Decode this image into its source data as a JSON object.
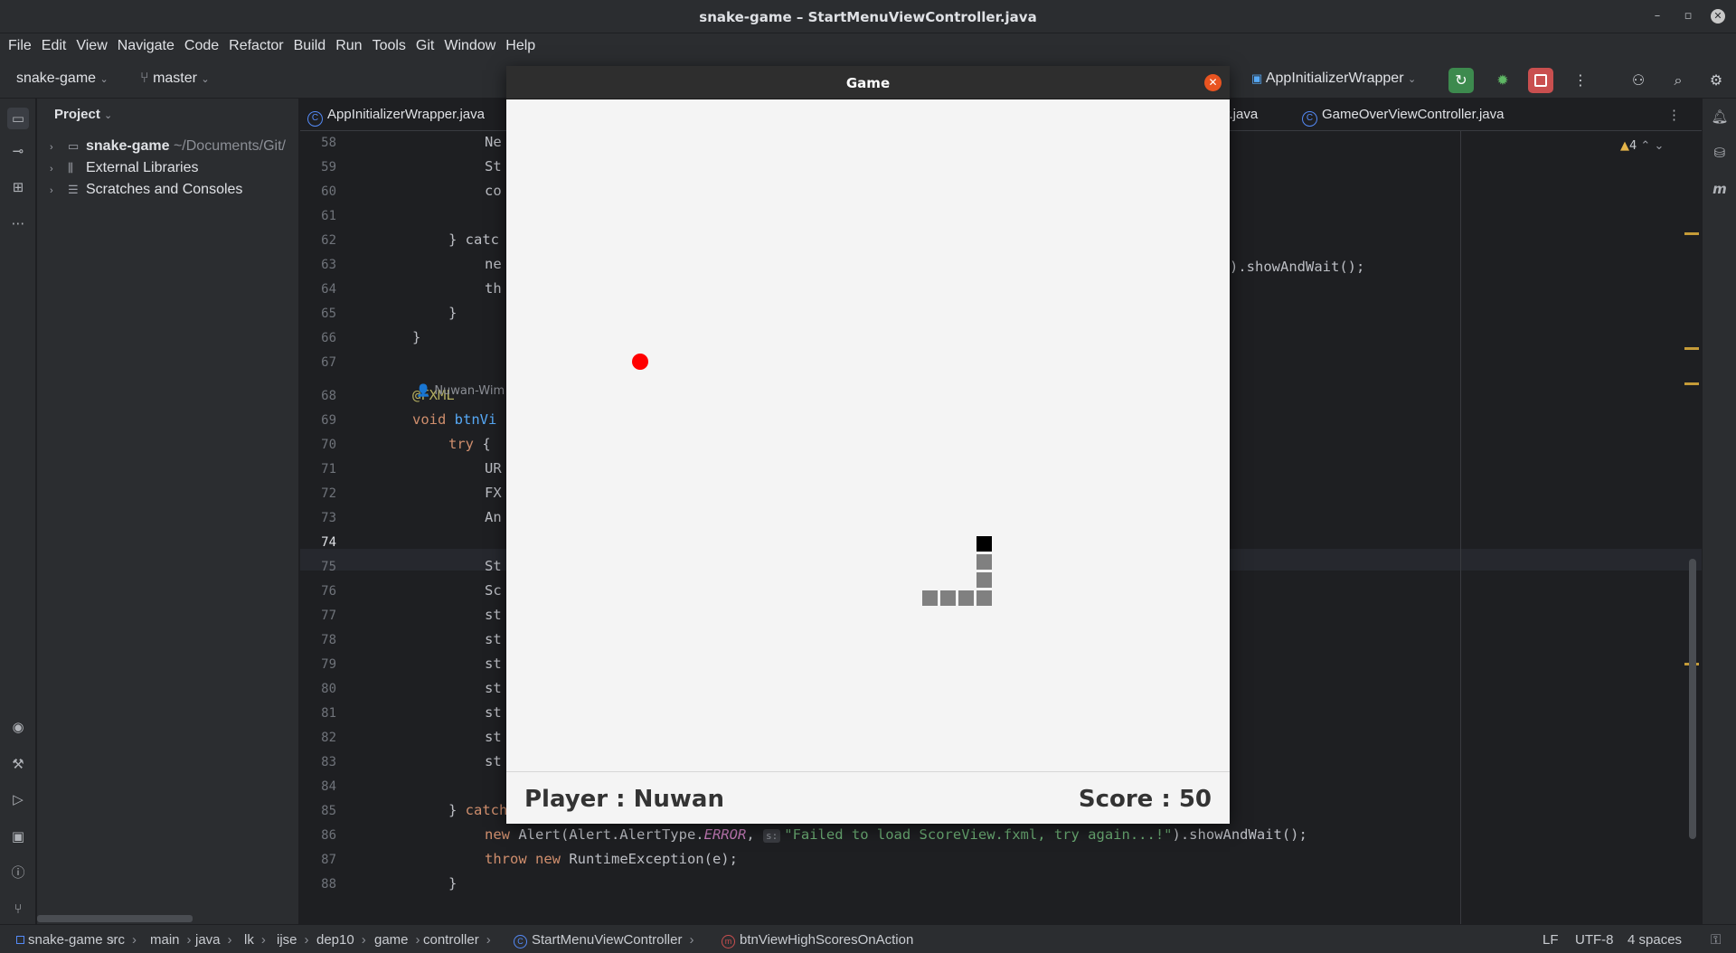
{
  "window": {
    "title": "snake-game – StartMenuViewController.java"
  },
  "menu": [
    "File",
    "Edit",
    "View",
    "Navigate",
    "Code",
    "Refactor",
    "Build",
    "Run",
    "Tools",
    "Git",
    "Window",
    "Help"
  ],
  "toolbar": {
    "project": "snake-game",
    "branch": "master",
    "run_config": "AppInitializerWrapper"
  },
  "project_panel": {
    "header": "Project",
    "items": [
      {
        "label": "snake-game",
        "path": "~/Documents/Git/"
      },
      {
        "label": "External Libraries"
      },
      {
        "label": "Scratches and Consoles"
      }
    ]
  },
  "tabs": [
    {
      "label": "AppInitializerWrapper.java"
    },
    {
      "label": "er.java"
    },
    {
      "label": "GameOverViewController.java"
    }
  ],
  "editor": {
    "warnings": "4",
    "author_hint": "Nuwan-Wim",
    "lines": [
      {
        "n": "58",
        "text": "Ne"
      },
      {
        "n": "59",
        "text": "St"
      },
      {
        "n": "60",
        "text": "co"
      },
      {
        "n": "61",
        "text": ""
      },
      {
        "n": "62",
        "text": "} catc"
      },
      {
        "n": "63",
        "text": "ne"
      },
      {
        "n": "64",
        "text": "th"
      },
      {
        "n": "65",
        "text": "}"
      },
      {
        "n": "66",
        "text": "}"
      },
      {
        "n": "67",
        "text": ""
      },
      {
        "n": "68",
        "text": "@FXML"
      },
      {
        "n": "69",
        "text": "void btnVi"
      },
      {
        "n": "70",
        "text": "try {"
      },
      {
        "n": "71",
        "text": "UR"
      },
      {
        "n": "72",
        "text": "FX"
      },
      {
        "n": "73",
        "text": "An"
      },
      {
        "n": "74",
        "text": ""
      },
      {
        "n": "75",
        "text": "St"
      },
      {
        "n": "76",
        "text": "Sc"
      },
      {
        "n": "77",
        "text": "st"
      },
      {
        "n": "78",
        "text": "st"
      },
      {
        "n": "79",
        "text": "st"
      },
      {
        "n": "80",
        "text": "st"
      },
      {
        "n": "81",
        "text": "st"
      },
      {
        "n": "82",
        "text": "st"
      },
      {
        "n": "83",
        "text": "st"
      },
      {
        "n": "84",
        "text": ""
      },
      {
        "n": "85",
        "text": "} catch (IOException e) {"
      },
      {
        "n": "86",
        "text": "new Alert(Alert.AlertType.ERROR,"
      },
      {
        "n": "87",
        "text": "throw new RuntimeException(e);"
      },
      {
        "n": "88",
        "text": "}"
      }
    ],
    "line63_tail": ").showAndWait();",
    "line86_hint": "s:",
    "line86_str": "\"Failed to load ScoreView.fxml, try again...!\"",
    "line86_tail": ").showAndWait();"
  },
  "statusbar": {
    "crumbs": [
      "snake-game",
      "src",
      "main",
      "java",
      "lk",
      "ijse",
      "dep10",
      "game",
      "controller",
      "StartMenuViewController",
      "btnViewHighScoresOnAction"
    ],
    "line_ending": "LF",
    "encoding": "UTF-8",
    "indent": "4 spaces"
  },
  "game": {
    "title": "Game",
    "player_label": "Player : Nuwan",
    "score_label": "Score : 50",
    "food_color": "#ff0000",
    "snake_head_color": "#000000",
    "snake_body_color": "#808080"
  }
}
